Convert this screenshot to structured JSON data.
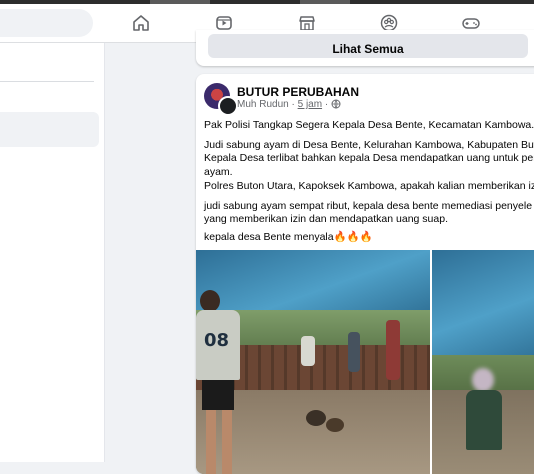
{
  "topbar": {
    "icons": [
      "home-icon",
      "video-icon",
      "marketplace-icon",
      "groups-icon",
      "gaming-icon"
    ]
  },
  "previous_card": {
    "see_all_label": "Lihat Semua"
  },
  "post": {
    "page_name": "BUTUR PERUBAHAN",
    "author": "Muh Rudun",
    "separator": "·",
    "time": "5 jam",
    "privacy_icon": "globe-icon",
    "paragraphs": [
      "Pak Polisi Tangkap Segera Kepala Desa Bente, Kecamatan Kambowa. j",
      "Judi sabung ayam di Desa Bente, Kelurahan Kambowa, Kabupaten But\nKepala Desa terlibat bahkan kepala Desa mendapatkan uang untuk per\nayam.",
      "Polres Buton Utara, Kapoksek Kambowa, apakah kalian memberikan izi",
      "judi sabung ayam sempat ribut, kepala desa bente memediasi penyele\nyang memberikan izin dan mendapatkan uang suap.",
      "kepala desa Bente menyala🔥🔥🔥"
    ],
    "photo_shirt_number": "08"
  }
}
